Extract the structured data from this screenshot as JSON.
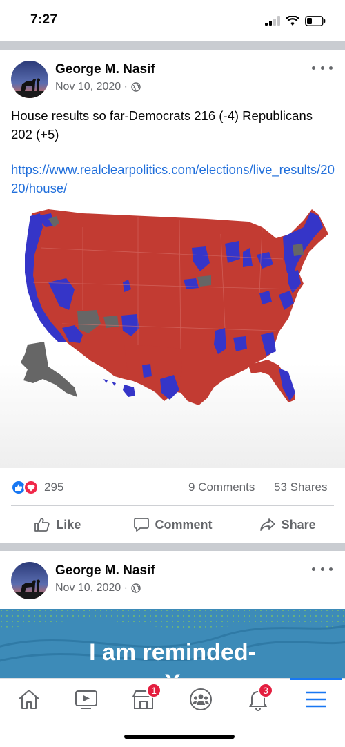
{
  "status_bar": {
    "time": "7:27"
  },
  "posts": [
    {
      "author": "George M. Nasif",
      "date": "Nov 10, 2020 ·",
      "text": "House results so far-Democrats 216 (-4) Republicans 202 (+5)",
      "link": "https://www.realclearpolitics.com/elections/live_results/2020/house/",
      "reactions_count": "295",
      "comments": "9 Comments",
      "shares": "53 Shares"
    },
    {
      "author": "George M. Nasif",
      "date": "Nov 10, 2020 ·",
      "banner_text": "I am reminded-",
      "banner_text_cut": "Y"
    }
  ],
  "actions": {
    "like": "Like",
    "comment": "Comment",
    "share": "Share"
  },
  "tabbar": {
    "items": [
      {
        "icon": "home-icon"
      },
      {
        "icon": "watch-icon"
      },
      {
        "icon": "marketplace-icon",
        "badge": "1"
      },
      {
        "icon": "groups-icon"
      },
      {
        "icon": "notifications-icon",
        "badge": "3"
      },
      {
        "icon": "menu-icon"
      }
    ]
  },
  "colors": {
    "link": "#216fdb",
    "democrat": "#3333cc",
    "republican": "#c0392b",
    "undecided": "#666666",
    "like_blue": "#1877f2",
    "love_red": "#f02849",
    "badge": "#e41e3f"
  }
}
